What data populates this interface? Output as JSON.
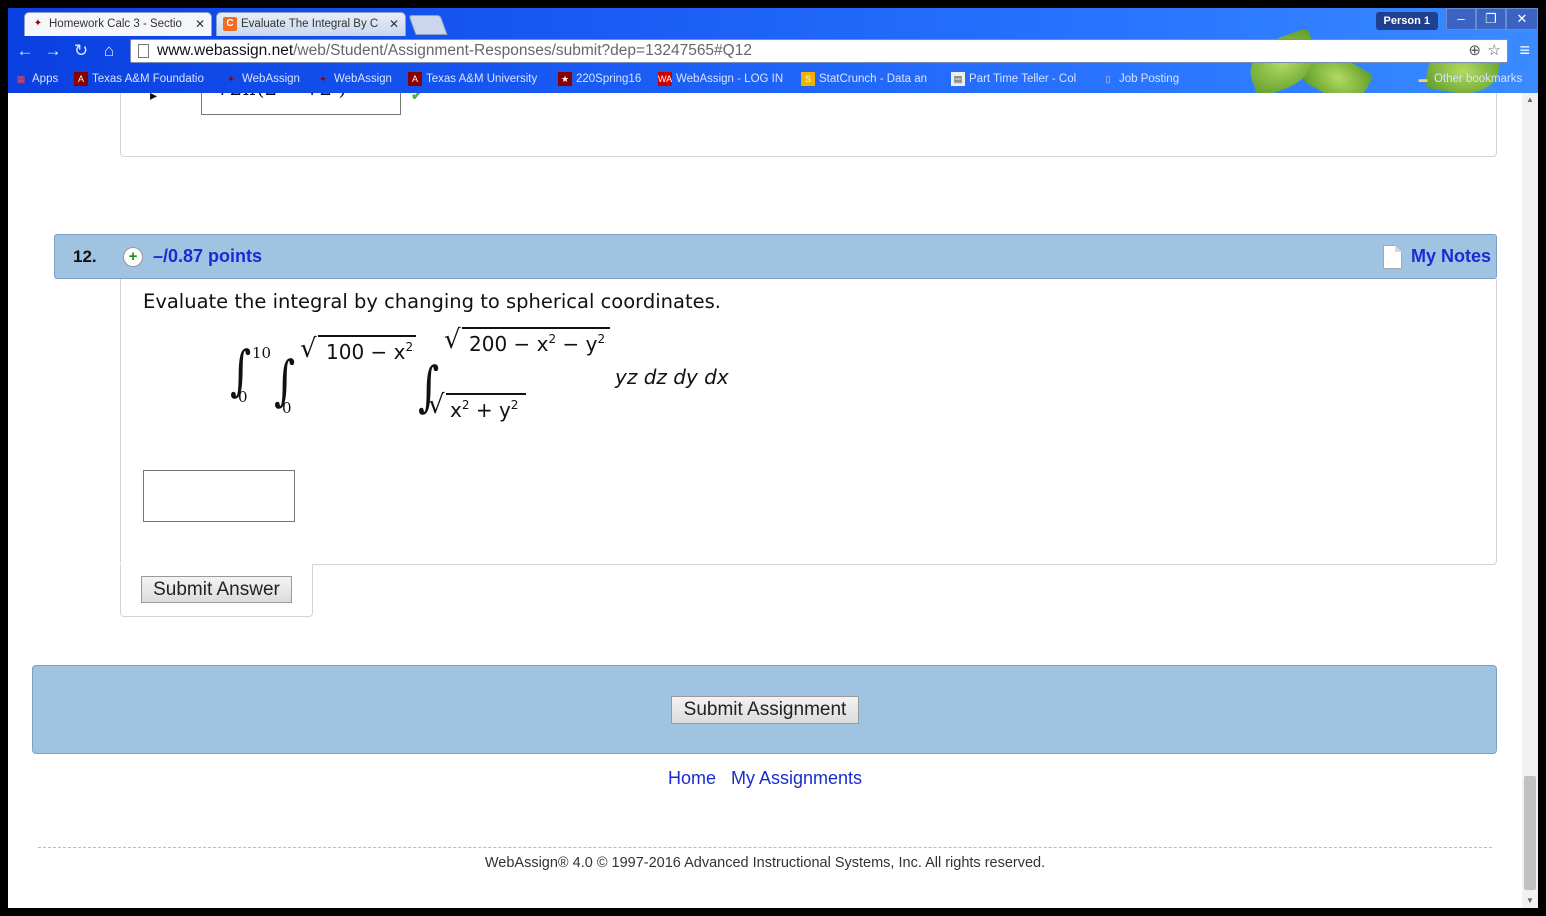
{
  "browser": {
    "tabs": [
      {
        "title": "Homework Calc 3 - Sectio",
        "icon": "aggie-icon"
      },
      {
        "title": "Evaluate The Integral By C",
        "icon": "chegg-icon"
      }
    ],
    "person_label": "Person 1",
    "url_host": "www.webassign.net",
    "url_path": "/web/Student/Assignment-Responses/submit?dep=13247565#Q12",
    "bookmarks": [
      {
        "label": "Apps"
      },
      {
        "label": "Texas A&M Foundatio"
      },
      {
        "label": "WebAssign"
      },
      {
        "label": "WebAssign"
      },
      {
        "label": "Texas A&M University"
      },
      {
        "label": "220Spring16"
      },
      {
        "label": "WebAssign - LOG IN"
      },
      {
        "label": "StatCrunch - Data an"
      },
      {
        "label": "Part Time Teller - Col"
      },
      {
        "label": "Job Posting"
      },
      {
        "label": "Other bookmarks"
      }
    ]
  },
  "question": {
    "number": "12.",
    "points": "–/0.87 points",
    "notes_label": "My Notes",
    "prompt": "Evaluate the integral by changing to spherical coordinates.",
    "math": {
      "int1_upper": "10",
      "int1_lower": "0",
      "int2_upper": "100 − x",
      "int2_lower": "0",
      "int3_upper": "200 − x",
      "int3_upper_tail": " − y",
      "int3_lower": "x",
      "int3_lower_tail": " + y",
      "exp": "2",
      "integrand": "yz dz dy dx"
    },
    "answer_value": "",
    "submit_label": "Submit Answer"
  },
  "assignment": {
    "submit_label": "Submit Assignment",
    "links": [
      "Home",
      "My Assignments"
    ],
    "copyright": "WebAssign® 4.0 © 1997-2016 Advanced Instructional Systems, Inc. All rights reserved."
  },
  "colors": {
    "header_blue": "#a0c3e2",
    "link_blue": "#1a2bd2"
  }
}
